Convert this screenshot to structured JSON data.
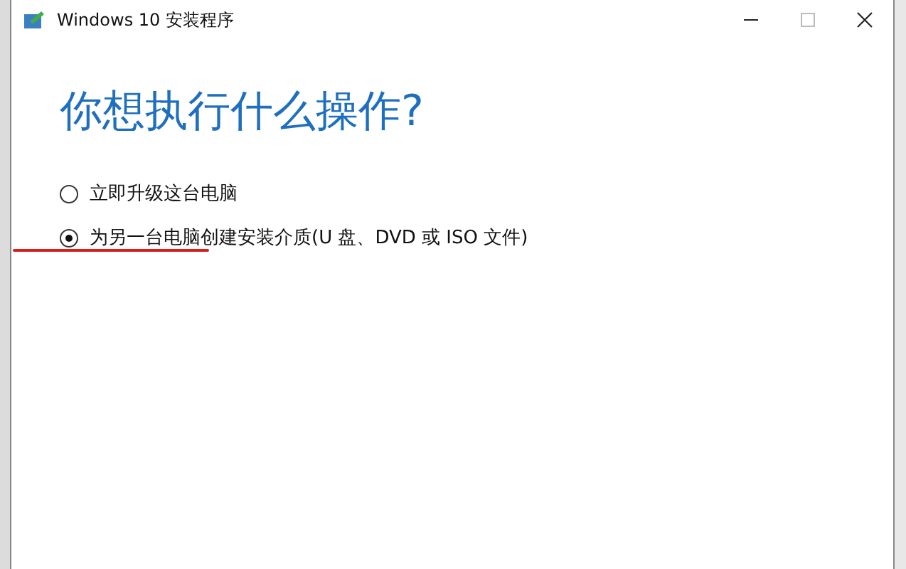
{
  "window": {
    "title": "Windows 10 安装程序"
  },
  "heading": "你想执行什么操作?",
  "options": [
    {
      "label": "立即升级这台电脑",
      "selected": false
    },
    {
      "label": "为另一台电脑创建安装介质(U 盘、DVD 或 ISO 文件)",
      "selected": true
    }
  ]
}
